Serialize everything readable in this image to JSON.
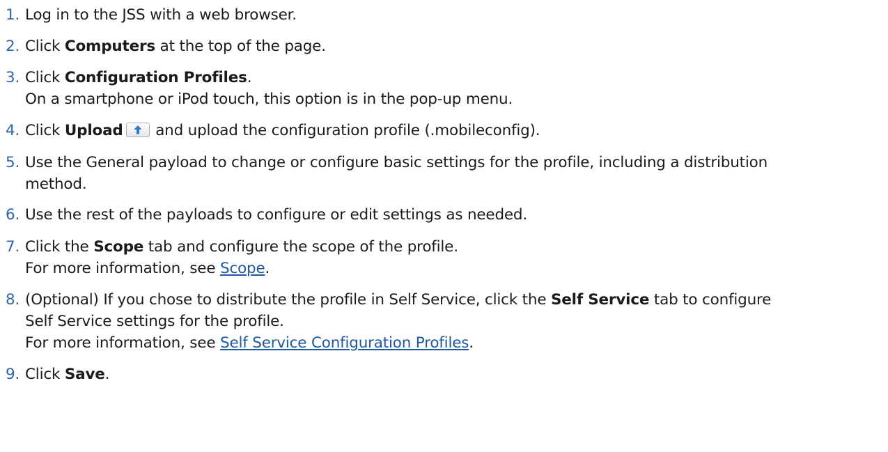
{
  "steps": [
    {
      "num": "1.",
      "text": "Log in to the JSS with a web browser."
    },
    {
      "num": "2.",
      "pre": "Click ",
      "bold": "Computers",
      "post": " at the top of the page."
    },
    {
      "num": "3.",
      "pre": "Click ",
      "bold": "Configuration Profiles",
      "post": ".",
      "note": "On a smartphone or iPod touch, this option is in the pop-up menu."
    },
    {
      "num": "4.",
      "pre": "Click ",
      "bold": "Upload",
      "icon": "upload-arrow-icon",
      "post": " and upload the configuration profile (.mobileconfig)."
    },
    {
      "num": "5.",
      "line1": "Use the General payload to change or configure basic settings for the profile, including a distribution",
      "line2": "method."
    },
    {
      "num": "6.",
      "text": "Use the rest of the payloads to configure or edit settings as needed."
    },
    {
      "num": "7.",
      "pre": "Click the ",
      "bold": "Scope",
      "post": " tab and configure the scope of the profile.",
      "note_pre": "For more information, see ",
      "link": "Scope",
      "note_post": "."
    },
    {
      "num": "8.",
      "pre": "(Optional) If you chose to distribute the profile in Self Service, click the ",
      "bold": "Self Service",
      "post": " tab to configure",
      "line2": "Self Service settings for the profile.",
      "note_pre": "For more information, see ",
      "link": "Self Service Configuration Profiles",
      "note_post": "."
    },
    {
      "num": "9.",
      "pre": "Click ",
      "bold": "Save",
      "post": "."
    }
  ]
}
